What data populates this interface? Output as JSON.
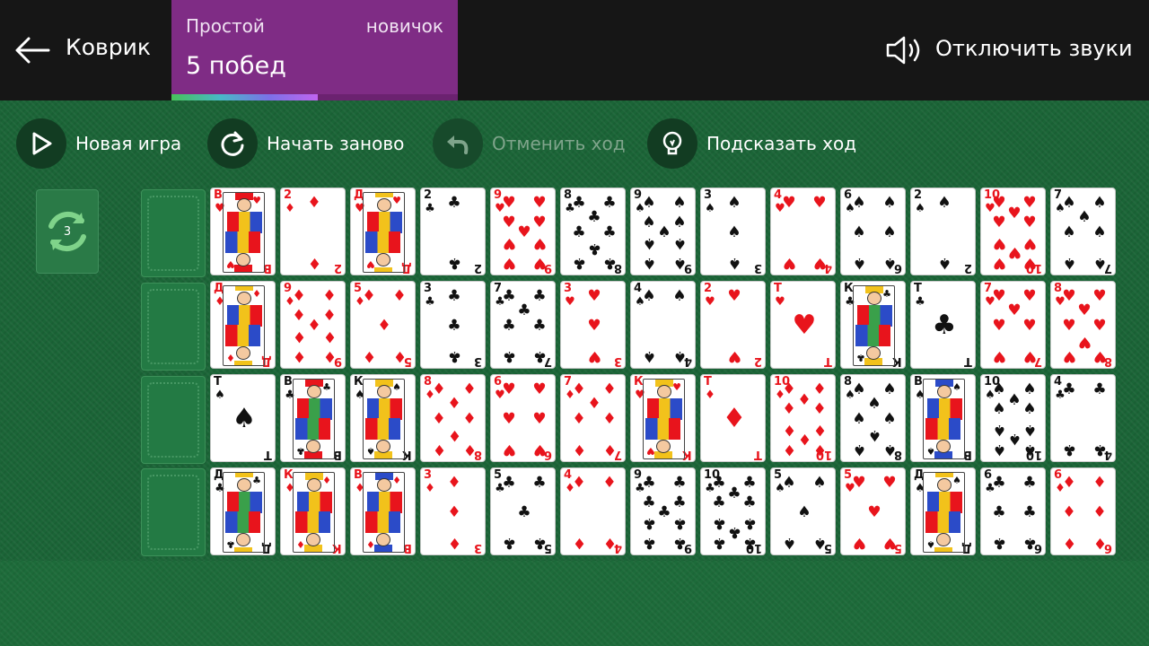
{
  "header": {
    "back_label": "Коврик",
    "level_name": "Простой",
    "level_rank": "новичок",
    "wins": "5 побед",
    "progress": 0.51,
    "sound_label": "Отключить звуки"
  },
  "toolbar": {
    "new_game": "Новая игра",
    "restart": "Начать заново",
    "undo": "Отменить ход",
    "hint": "Подсказать ход"
  },
  "stock": {
    "count": "3"
  },
  "colors": {
    "felt": "#1d6b3a",
    "header": "#161616",
    "level_bg": "#7f2c85",
    "red": "#e8141c",
    "black": "#111111"
  },
  "rows": [
    [
      {
        "r": "В",
        "s": "♥"
      },
      {
        "r": "2",
        "s": "♦"
      },
      {
        "r": "Д",
        "s": "♥"
      },
      {
        "r": "2",
        "s": "♣"
      },
      {
        "r": "9",
        "s": "♥"
      },
      {
        "r": "8",
        "s": "♣"
      },
      {
        "r": "9",
        "s": "♠"
      },
      {
        "r": "3",
        "s": "♠"
      },
      {
        "r": "4",
        "s": "♥"
      },
      {
        "r": "6",
        "s": "♠"
      },
      {
        "r": "2",
        "s": "♠"
      },
      {
        "r": "10",
        "s": "♥"
      },
      {
        "r": "7",
        "s": "♠"
      }
    ],
    [
      {
        "r": "Д",
        "s": "♦"
      },
      {
        "r": "9",
        "s": "♦"
      },
      {
        "r": "5",
        "s": "♦"
      },
      {
        "r": "3",
        "s": "♣"
      },
      {
        "r": "7",
        "s": "♣"
      },
      {
        "r": "3",
        "s": "♥"
      },
      {
        "r": "4",
        "s": "♠"
      },
      {
        "r": "2",
        "s": "♥"
      },
      {
        "r": "Т",
        "s": "♥"
      },
      {
        "r": "К",
        "s": "♣"
      },
      {
        "r": "Т",
        "s": "♣"
      },
      {
        "r": "7",
        "s": "♥"
      },
      {
        "r": "8",
        "s": "♥"
      }
    ],
    [
      {
        "r": "Т",
        "s": "♠"
      },
      {
        "r": "В",
        "s": "♣"
      },
      {
        "r": "К",
        "s": "♠"
      },
      {
        "r": "8",
        "s": "♦"
      },
      {
        "r": "6",
        "s": "♥"
      },
      {
        "r": "7",
        "s": "♦"
      },
      {
        "r": "К",
        "s": "♥"
      },
      {
        "r": "Т",
        "s": "♦"
      },
      {
        "r": "10",
        "s": "♦"
      },
      {
        "r": "8",
        "s": "♠"
      },
      {
        "r": "В",
        "s": "♠"
      },
      {
        "r": "10",
        "s": "♠"
      },
      {
        "r": "4",
        "s": "♣"
      }
    ],
    [
      {
        "r": "Д",
        "s": "♣"
      },
      {
        "r": "К",
        "s": "♦"
      },
      {
        "r": "В",
        "s": "♦"
      },
      {
        "r": "3",
        "s": "♦"
      },
      {
        "r": "5",
        "s": "♣"
      },
      {
        "r": "4",
        "s": "♦"
      },
      {
        "r": "9",
        "s": "♣"
      },
      {
        "r": "10",
        "s": "♣"
      },
      {
        "r": "5",
        "s": "♠"
      },
      {
        "r": "5",
        "s": "♥"
      },
      {
        "r": "Д",
        "s": "♠"
      },
      {
        "r": "6",
        "s": "♣"
      },
      {
        "r": "6",
        "s": "♦"
      }
    ]
  ]
}
